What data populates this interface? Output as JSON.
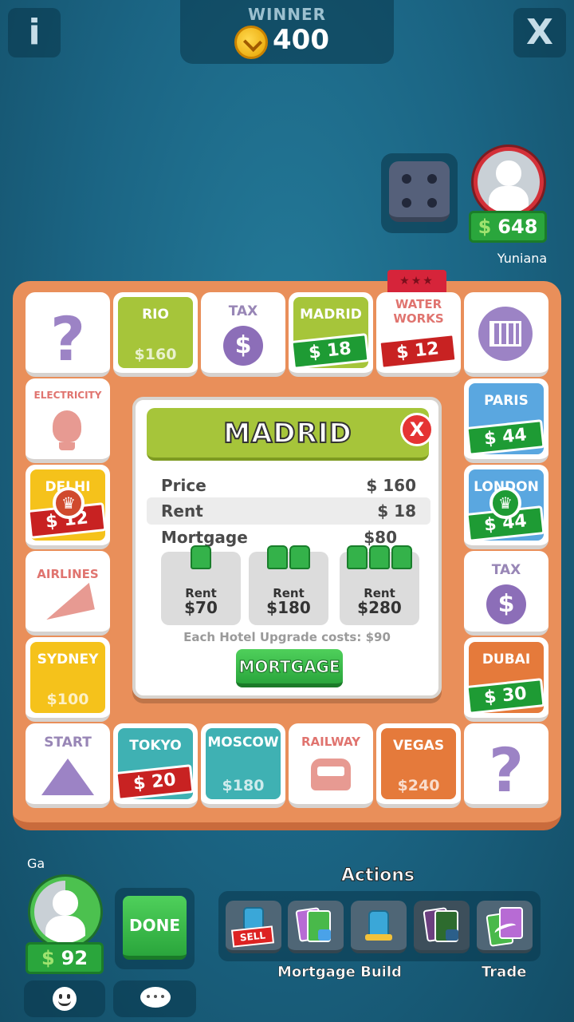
{
  "top": {
    "info_icon": "i",
    "close_icon": "X",
    "winner_label": "WINNER",
    "winner_amount": "400"
  },
  "opponent": {
    "name": "Yuniana",
    "cash_symbol": "$",
    "cash": "648"
  },
  "board": {
    "top": [
      {
        "type": "chance",
        "glyph": "?"
      },
      {
        "name": "RIO",
        "price": "$160",
        "color": "#a6c53a"
      },
      {
        "name": "TAX",
        "type": "tax",
        "glyph": "$"
      },
      {
        "name": "MADRID",
        "tag": "$ 18",
        "tag_color": "green",
        "color": "#a6c53a"
      },
      {
        "name": "WATER WORKS",
        "tag": "$ 12",
        "tag_color": "red"
      },
      {
        "type": "jail"
      }
    ],
    "left": [
      {
        "name": "ELECTRICITY",
        "type": "utility"
      },
      {
        "name": "DELHI",
        "tag": "$ 12",
        "color": "#f5c21b"
      },
      {
        "name": "AIRLINES",
        "type": "travel"
      },
      {
        "name": "SYDNEY",
        "price": "$100",
        "color": "#f5c21b"
      }
    ],
    "right": [
      {
        "name": "PARIS",
        "tag": "$ 44",
        "color": "#5aa7e0"
      },
      {
        "name": "LONDON",
        "tag": "$ 44",
        "color": "#5aa7e0"
      },
      {
        "name": "TAX",
        "type": "tax",
        "glyph": "$"
      },
      {
        "name": "DUBAI",
        "tag": "$ 30",
        "color": "#e57a3b"
      }
    ],
    "bottom": [
      {
        "name": "START",
        "type": "start"
      },
      {
        "name": "TOKYO",
        "tag": "$ 20",
        "color": "#3fb1b3"
      },
      {
        "name": "MOSCOW",
        "price": "$180",
        "color": "#3fb1b3"
      },
      {
        "name": "RAILWAY",
        "type": "railway"
      },
      {
        "name": "VEGAS",
        "price": "$240",
        "color": "#e57a3b"
      },
      {
        "type": "chance",
        "glyph": "?"
      }
    ]
  },
  "popup": {
    "title": "MADRID",
    "close": "X",
    "rows": [
      {
        "label": "Price",
        "value": "$ 160"
      },
      {
        "label": "Rent",
        "value": "$ 18"
      },
      {
        "label": "Mortgage",
        "value": "$80"
      }
    ],
    "houses": [
      {
        "label": "Rent",
        "value": "$70"
      },
      {
        "label": "Rent",
        "value": "$180"
      },
      {
        "label": "Rent",
        "value": "$280"
      }
    ],
    "upgrade_text": "Each Hotel Upgrade costs: $90",
    "mortgage_button": "MORTGAGE"
  },
  "player": {
    "name": "Ga",
    "cash_symbol": "$",
    "cash": "92",
    "done_button": "DONE"
  },
  "actions": {
    "title": "Actions",
    "sell_label": "SELL",
    "caption_mortgage_build": "Mortgage Build",
    "caption_trade": "Trade"
  },
  "colors": {
    "green_group": "#a6c53a",
    "yellow_group": "#f5c21b",
    "blue_group": "#5aa7e0",
    "orange_group": "#e57a3b",
    "teal_group": "#3fb1b3",
    "board": "#e98f5a"
  }
}
